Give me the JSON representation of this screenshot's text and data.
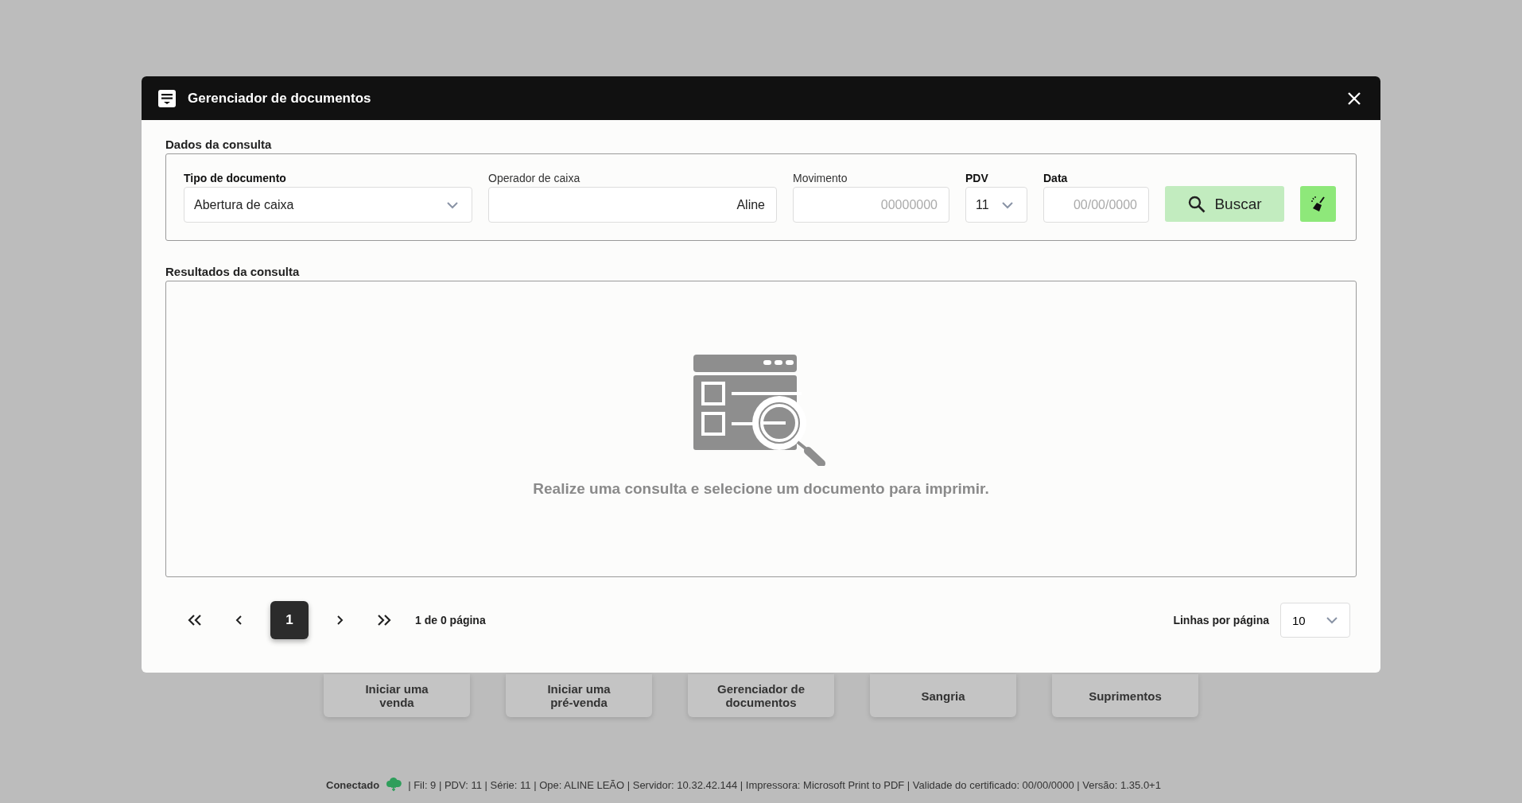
{
  "background_tiles": [
    {
      "lines": [
        "Iniciar uma",
        "venda"
      ]
    },
    {
      "lines": [
        "Iniciar uma",
        "pré-venda"
      ]
    },
    {
      "lines": [
        "Gerenciador de",
        "documentos"
      ]
    },
    {
      "lines": [
        "Sangria"
      ]
    },
    {
      "lines": [
        "Suprimentos"
      ]
    }
  ],
  "status_bar": {
    "connection": "Conectado",
    "details": "| Fil: 9 | PDV: 11 | Série: 11 | Ope: ALINE LEÃO | Servidor: 10.32.42.144 | Impressora: Microsoft Print to PDF | Validade do certificado: 00/00/0000 | Versão: 1.35.0+1"
  },
  "window": {
    "title": "Gerenciador de documentos"
  },
  "query": {
    "title": "Dados da consulta",
    "fields": [
      {
        "kind": "select",
        "label": "Tipo de documento",
        "required": true,
        "value": "Abertura de caixa"
      },
      {
        "kind": "input",
        "label": "Operador de caixa",
        "required": false,
        "value": "Aline"
      },
      {
        "kind": "input",
        "label": "Movimento",
        "required": false,
        "placeholder": "00000000"
      },
      {
        "kind": "select",
        "label": "PDV",
        "required": true,
        "value": "11"
      },
      {
        "kind": "input",
        "label": "Data",
        "required": true,
        "placeholder": "00/00/0000"
      }
    ],
    "search_button": "Buscar"
  },
  "results": {
    "title": "Resultados da consulta",
    "empty_message": "Realize uma consulta e selecione um documento para imprimir."
  },
  "pagination": {
    "pages": [
      {
        "label": "1",
        "selected": true
      }
    ],
    "summary": "1 de 0 página",
    "rows_label": "Linhas por página",
    "rows_value": "10"
  }
}
